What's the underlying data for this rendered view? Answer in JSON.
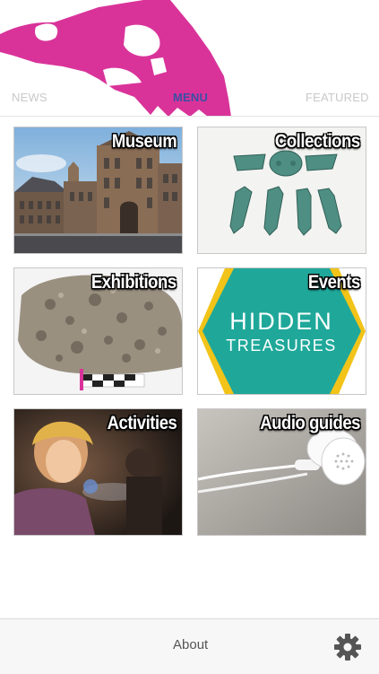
{
  "nav": {
    "tabs": [
      {
        "label": "NEWS"
      },
      {
        "label": "MENU"
      },
      {
        "label": "FEATURED"
      }
    ],
    "active": "MENU"
  },
  "menu": {
    "tiles": [
      {
        "label": "Museum",
        "image": "museum-building"
      },
      {
        "label": "Collections",
        "image": "green-artifacts"
      },
      {
        "label": "Exhibitions",
        "image": "fossil-rock"
      },
      {
        "label": "Events",
        "image": "hidden-treasures-logo",
        "logo_lines": [
          "HIDDEN",
          "TREASURES"
        ]
      },
      {
        "label": "Activities",
        "image": "child-with-torch"
      },
      {
        "label": "Audio guides",
        "image": "earphones"
      }
    ]
  },
  "footer": {
    "about_label": "About",
    "settings_icon": "gear-icon"
  },
  "colors": {
    "brand_magenta": "#d9339a",
    "active_tab": "#3b4fa3",
    "inactive_tab": "#c9c9c9",
    "events_teal": "#1fa89a",
    "events_yellow": "#f2c318"
  }
}
